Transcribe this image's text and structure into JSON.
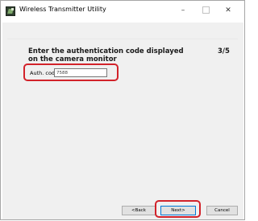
{
  "window": {
    "title": "Wireless Transmitter Utility",
    "minimize_glyph": "–",
    "close_glyph": "✕"
  },
  "wizard": {
    "prompt": "Enter the authentication code displayed on the camera monitor",
    "step": "3/5",
    "auth_code": {
      "label": "Auth. code",
      "value": "7588"
    }
  },
  "buttons": {
    "back": "<Back",
    "next": "Next>",
    "cancel": "Cancel"
  },
  "highlight_color": "#d2222a",
  "icons": [
    "app-icon"
  ]
}
